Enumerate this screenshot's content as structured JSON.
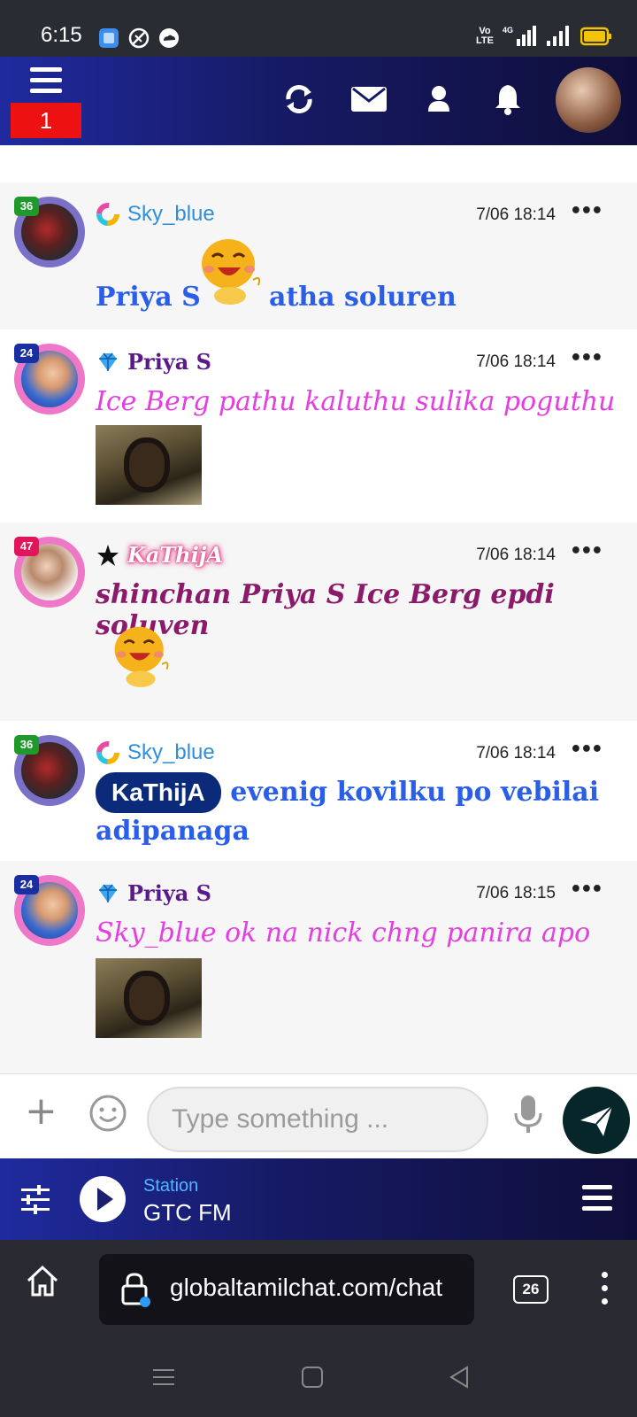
{
  "status": {
    "time": "6:15",
    "network_top": "Vo",
    "network_mid": "LTE",
    "network_gen": "4G"
  },
  "topnav": {
    "notification_count": "1"
  },
  "messages": [
    {
      "username": "Sky_blue",
      "time": "7/06 18:14",
      "level": "36",
      "text_before": "Priya S",
      "text_after": "atha soluren",
      "name_color": "#2f8fdb",
      "text_color": "#2a5ee8"
    },
    {
      "username": "Priya S",
      "time": "7/06 18:14",
      "level": "24",
      "text": "Ice Berg pathu kaluthu sulika poguthu",
      "name_color": "#5a1a8a",
      "text_color": "#e53ee0"
    },
    {
      "username": "KaThijA",
      "time": "7/06 18:14",
      "level": "47",
      "text": "shinchan Priya S Ice Berg epdi soluven",
      "name_color": "#e0307a",
      "text_color": "#8b1a6a"
    },
    {
      "username": "Sky_blue",
      "time": "7/06 18:14",
      "level": "36",
      "mention": "KaThijA",
      "text_line1": "evenig kovilku po vebilai",
      "text_line2": "adipanaga",
      "name_color": "#2f8fdb",
      "text_color": "#2a5ee8"
    },
    {
      "username": "Priya S",
      "time": "7/06 18:15",
      "level": "24",
      "text": "Sky_blue ok na nick chng panira apo",
      "name_color": "#5a1a8a",
      "text_color": "#e53ee0"
    }
  ],
  "composer": {
    "placeholder": "Type something ..."
  },
  "radio": {
    "label": "Station",
    "name": "GTC FM"
  },
  "browser": {
    "url": "globaltamilchat.com/chat",
    "tab_count": "26"
  },
  "colors": {
    "nav_gradient_start": "#1f2a9e",
    "nav_gradient_end": "#0f0e3a",
    "send_button": "#06262a",
    "notification_badge": "#ee1111"
  }
}
